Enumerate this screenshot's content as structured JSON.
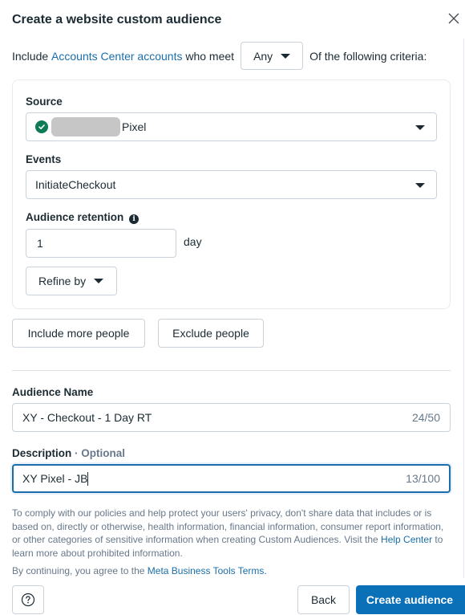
{
  "dialog": {
    "title": "Create a website custom audience",
    "close_icon": "close-icon"
  },
  "include_row": {
    "prefix": "Include",
    "link": "Accounts Center accounts",
    "middle": "who meet",
    "match_select": {
      "value": "Any"
    },
    "suffix": "Of the following criteria:"
  },
  "criteria": {
    "source": {
      "label": "Source",
      "status_icon": "check-circle-icon",
      "value_suffix": "Pixel"
    },
    "events": {
      "label": "Events",
      "value": "InitiateCheckout"
    },
    "retention": {
      "label": "Audience retention",
      "info_icon": "info-icon",
      "value": "1",
      "unit": "day"
    },
    "refine_label": "Refine by"
  },
  "actions": {
    "include_more": "Include more people",
    "exclude": "Exclude people"
  },
  "audience_name": {
    "label": "Audience Name",
    "value": "XY - Checkout - 1 Day RT",
    "counter": "24/50"
  },
  "description": {
    "label": "Description",
    "optional": "· Optional",
    "value": "XY Pixel - JB",
    "counter": "13/100"
  },
  "notice": {
    "text_before": "To comply with our policies and help protect your users' privacy, don't share data that includes or is based on, directly or otherwise, health information, financial information, consumer report information, or other categories of sensitive information when creating Custom Audiences. Visit the ",
    "link": "Help Center",
    "text_after": " to learn more about prohibited information."
  },
  "terms": {
    "prefix": "By continuing, you agree to the ",
    "link": "Meta Business Tools Terms."
  },
  "footer": {
    "help_icon": "help-icon",
    "back": "Back",
    "create": "Create audience"
  },
  "colors": {
    "primary": "#0a70b8",
    "link": "#1a6ea9",
    "success": "#0e7a56",
    "muted_text": "#67788a"
  }
}
